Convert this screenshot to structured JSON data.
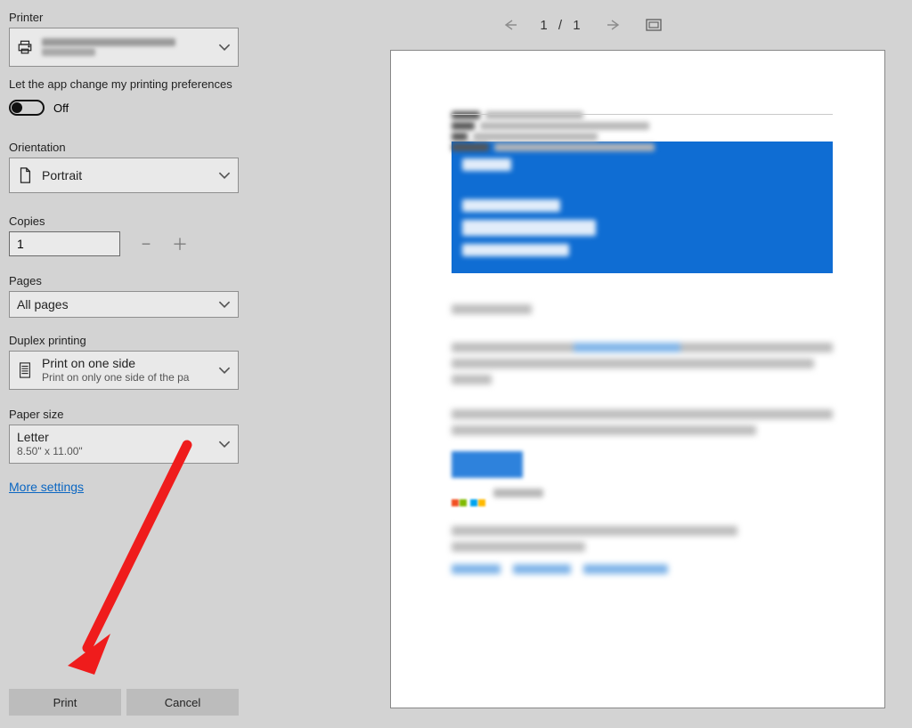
{
  "printer": {
    "label": "Printer"
  },
  "appPrefs": {
    "label": "Let the app change my printing preferences",
    "state": "Off"
  },
  "orientation": {
    "label": "Orientation",
    "value": "Portrait"
  },
  "copies": {
    "label": "Copies",
    "value": "1"
  },
  "pages": {
    "label": "Pages",
    "value": "All pages"
  },
  "duplex": {
    "label": "Duplex printing",
    "value": "Print on one side",
    "sub": "Print on only one side of the pa"
  },
  "paper": {
    "label": "Paper size",
    "value": "Letter",
    "sub": "8.50\" x 11.00\""
  },
  "moreSettings": "More settings",
  "buttons": {
    "print": "Print",
    "cancel": "Cancel"
  },
  "preview": {
    "page_current": "1",
    "page_sep": "/",
    "page_total": "1"
  }
}
